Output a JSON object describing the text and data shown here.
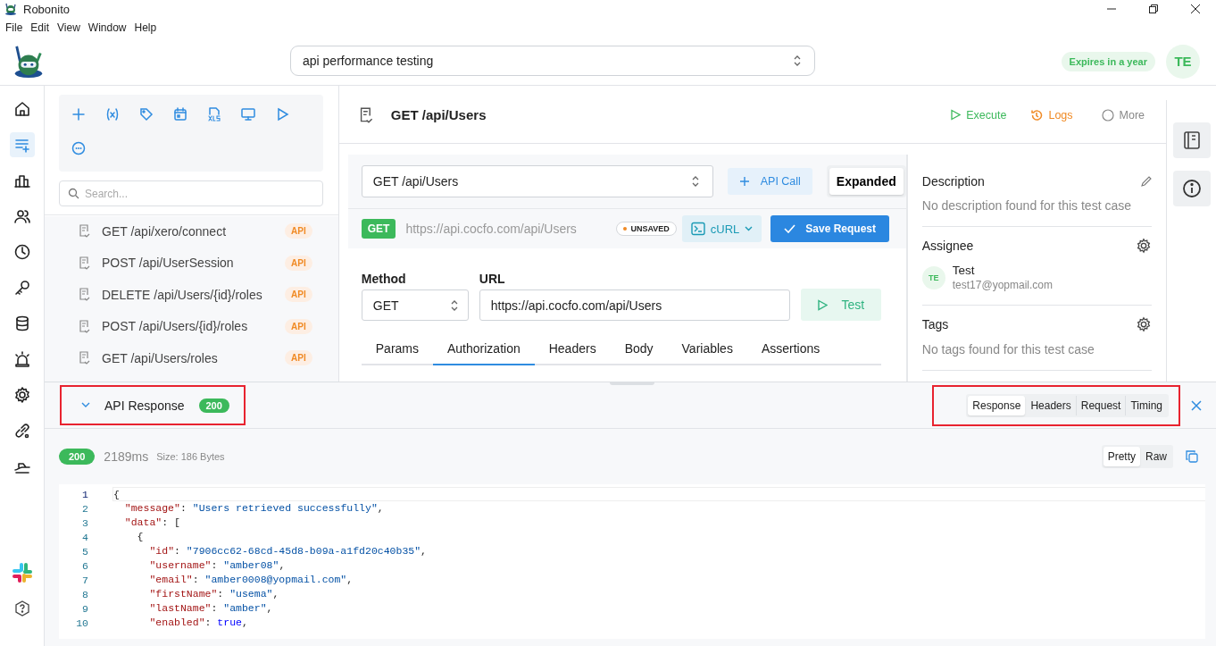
{
  "window": {
    "title": "Robonito"
  },
  "menu": [
    "File",
    "Edit",
    "View",
    "Window",
    "Help"
  ],
  "header": {
    "project": "api performance testing",
    "license": "Expires in a year",
    "avatar": "TE"
  },
  "nav": [
    {
      "kind": "home",
      "selected": false
    },
    {
      "kind": "list",
      "selected": true
    },
    {
      "kind": "chart",
      "selected": false
    },
    {
      "kind": "users",
      "selected": false
    },
    {
      "kind": "clock",
      "selected": false
    },
    {
      "kind": "key",
      "selected": false
    },
    {
      "kind": "database",
      "selected": false
    },
    {
      "kind": "alarm",
      "selected": false
    },
    {
      "kind": "gear",
      "selected": false
    },
    {
      "kind": "link",
      "selected": false
    },
    {
      "kind": "boat",
      "selected": false
    }
  ],
  "nav_bottom": [
    {
      "kind": "slack"
    },
    {
      "kind": "help"
    }
  ],
  "sidebar": {
    "search": {
      "placeholder": "Search..."
    },
    "items": [
      {
        "label": "GET /api/xero/connect",
        "tag": "API"
      },
      {
        "label": "POST /api/UserSession",
        "tag": "API"
      },
      {
        "label": "DELETE /api/Users/{id}/roles",
        "tag": "API"
      },
      {
        "label": "POST /api/Users/{id}/roles",
        "tag": "API"
      },
      {
        "label": "GET /api/Users/roles",
        "tag": "API"
      }
    ]
  },
  "test_case": {
    "title": "GET /api/Users",
    "actions": [
      {
        "kind": "execute",
        "label": "Execute"
      },
      {
        "kind": "logs",
        "label": "Logs"
      },
      {
        "kind": "more",
        "label": "More"
      }
    ]
  },
  "request": {
    "selector": "GET /api/Users",
    "add_button": "API Call",
    "view_button": "Expanded",
    "method_badge": "GET",
    "url_preview": "https://api.cocfo.com/api/Users",
    "status_badge": "UNSAVED",
    "format_button": "cURL",
    "save_button": "Save Request",
    "method_label": "Method",
    "method": "GET",
    "url_label": "URL",
    "url": "https://api.cocfo.com/api/Users",
    "test_button": "Test",
    "tabs": [
      {
        "label": "Params",
        "selected": false
      },
      {
        "label": "Authorization",
        "selected": true
      },
      {
        "label": "Headers",
        "selected": false
      },
      {
        "label": "Body",
        "selected": false
      },
      {
        "label": "Variables",
        "selected": false
      },
      {
        "label": "Assertions",
        "selected": false
      }
    ]
  },
  "details": {
    "description": {
      "title": "Description",
      "text": "No description found for this test case"
    },
    "assignee": {
      "title": "Assignee",
      "initials": "TE",
      "name": "Test",
      "email": "test17@yopmail.com"
    },
    "tags": {
      "title": "Tags",
      "text": "No tags found for this test case"
    }
  },
  "response": {
    "title": "API Response",
    "status": "200",
    "highlighted": true,
    "tabs_highlighted": true,
    "tabs": [
      {
        "label": "Response",
        "selected": true
      },
      {
        "label": "Headers",
        "selected": false
      },
      {
        "label": "Request",
        "selected": false
      },
      {
        "label": "Timing",
        "selected": false
      }
    ],
    "status_badge": "200",
    "time": "2189ms",
    "size": "Size: 186 Bytes",
    "view_modes": [
      {
        "label": "Pretty",
        "selected": true
      },
      {
        "label": "Raw",
        "selected": false
      }
    ],
    "lines": [
      {
        "number": "1",
        "text": "{",
        "active": true
      },
      {
        "number": "2",
        "text": "  \"message\": \"Users retrieved successfully\",",
        "active": false
      },
      {
        "number": "3",
        "text": "  \"data\": [",
        "active": false
      },
      {
        "number": "4",
        "text": "    {",
        "active": false
      },
      {
        "number": "5",
        "text": "      \"id\": \"7906cc62-68cd-45d8-b09a-a1fd20c40b35\",",
        "active": false
      },
      {
        "number": "6",
        "text": "      \"username\": \"amber08\",",
        "active": false
      },
      {
        "number": "7",
        "text": "      \"email\": \"amber0008@yopmail.com\",",
        "active": false
      },
      {
        "number": "8",
        "text": "      \"firstName\": \"usema\",",
        "active": false
      },
      {
        "number": "9",
        "text": "      \"lastName\": \"amber\",",
        "active": false
      },
      {
        "number": "10",
        "text": "      \"enabled\": true,",
        "active": false
      }
    ]
  }
}
